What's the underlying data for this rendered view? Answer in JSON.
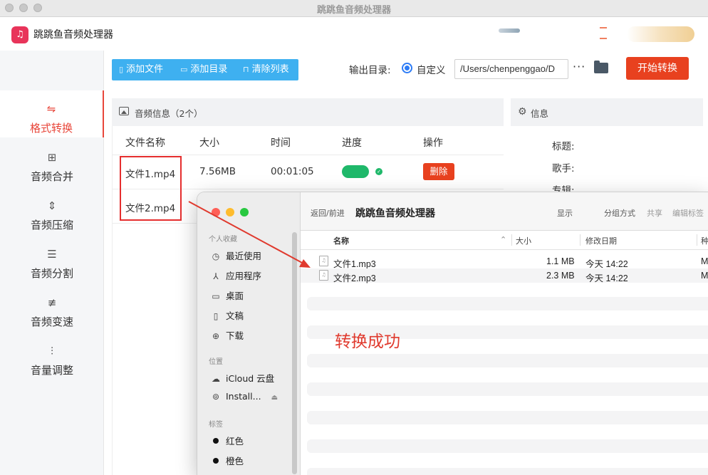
{
  "window": {
    "title": "跳跳鱼音频处理器"
  },
  "app": {
    "name": "跳跳鱼音频处理器",
    "logo_icon": "headphones-icon"
  },
  "sidebar": {
    "items": [
      {
        "label": "格式转换",
        "icon": "format-convert-icon",
        "active": true
      },
      {
        "label": "音频合并",
        "icon": "merge-icon"
      },
      {
        "label": "音频压缩",
        "icon": "compress-icon"
      },
      {
        "label": "音频分割",
        "icon": "split-icon"
      },
      {
        "label": "音频变速",
        "icon": "speed-icon"
      },
      {
        "label": "音量调整",
        "icon": "volume-icon"
      }
    ]
  },
  "toolbar": {
    "add_file": "添加文件",
    "add_dir": "添加目录",
    "clear_list": "清除列表",
    "output_label": "输出目录:",
    "custom_label": "自定义",
    "output_path": "/Users/chenpenggao/D",
    "more": "···",
    "start": "开始转换"
  },
  "audio_panel": {
    "title": "音频信息（2个）",
    "columns": [
      "文件名称",
      "大小",
      "时间",
      "进度",
      "操作"
    ],
    "rows": [
      {
        "name": "文件1.mp4",
        "size": "7.56MB",
        "time": "00:01:05",
        "progress": 1.0,
        "action": "删除"
      },
      {
        "name": "文件2.mp4"
      }
    ]
  },
  "info_panel": {
    "title": "信息",
    "fields": [
      "标题:",
      "歌手:",
      "专辑:"
    ]
  },
  "finder": {
    "nav": "返回/前进",
    "title": "跳跳鱼音频处理器",
    "tools": [
      "显示",
      "分组方式",
      "共享",
      "编辑标签"
    ],
    "sections": {
      "favorites": "个人收藏",
      "locations": "位置",
      "tags": "标签"
    },
    "favorites": [
      {
        "label": "最近使用",
        "icon": "clock-icon"
      },
      {
        "label": "应用程序",
        "icon": "applications-icon"
      },
      {
        "label": "桌面",
        "icon": "desktop-icon"
      },
      {
        "label": "文稿",
        "icon": "document-icon"
      },
      {
        "label": "下载",
        "icon": "download-icon"
      }
    ],
    "locations": [
      {
        "label": "iCloud 云盘",
        "icon": "cloud-icon"
      },
      {
        "label": "Install...",
        "icon": "disk-icon"
      }
    ],
    "tags": [
      {
        "label": "红色",
        "color": "#111111"
      },
      {
        "label": "橙色",
        "color": "#111111"
      }
    ],
    "columns": {
      "name": "名称",
      "size": "大小",
      "modified": "修改日期",
      "kind": "种"
    },
    "files": [
      {
        "name": "文件1.mp3",
        "size": "1.1 MB",
        "modified": "今天 14:22",
        "kind": "M"
      },
      {
        "name": "文件2.mp3",
        "size": "2.3 MB",
        "modified": "今天 14:22",
        "kind": "M"
      }
    ]
  },
  "annotation": {
    "text": "转换成功",
    "color": "#e03a2e"
  }
}
